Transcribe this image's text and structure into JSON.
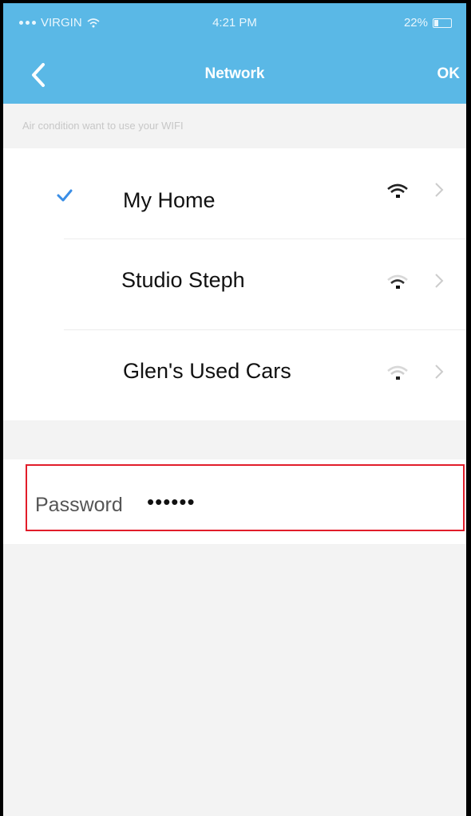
{
  "status_bar": {
    "carrier": "VIRGIN",
    "time": "4:21 PM",
    "battery": "22%"
  },
  "nav": {
    "title": "Network",
    "ok_label": "OK",
    "back_icon": "chevron-left-icon"
  },
  "hint": "Air condition want to use your WIFI",
  "networks": [
    {
      "name": "My Home",
      "selected": true,
      "signal": 3
    },
    {
      "name": "Studio Steph",
      "selected": false,
      "signal": 2
    },
    {
      "name": "Glen's Used Cars",
      "selected": false,
      "signal": 1
    }
  ],
  "password": {
    "label": "Password",
    "value": "••••••"
  },
  "colors": {
    "accent": "#5ab8e6",
    "check": "#3a8ee6",
    "highlight": "#e11d2a",
    "background": "#f3f3f3"
  }
}
